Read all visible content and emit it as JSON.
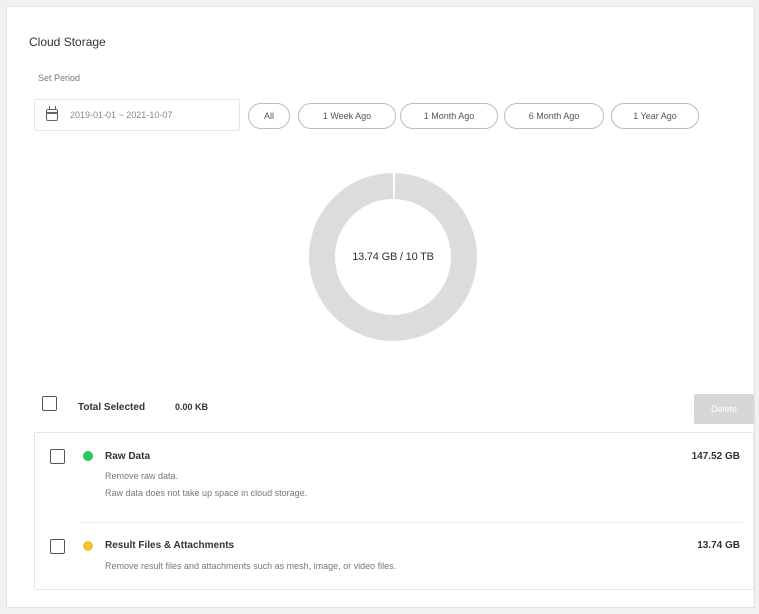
{
  "card": {
    "title": "Cloud Storage",
    "set_period_label": "Set Period",
    "date_range": "2019-01-01 ~ 2021-10-07"
  },
  "period_chips": [
    "All",
    "1 Week Ago",
    "1 Month Ago",
    "6 Month Ago",
    "1 Year Ago"
  ],
  "usage": {
    "label": "13.74 GB / 10 TB",
    "used_fraction": 0.0013,
    "ring_color": "#dcdcdc"
  },
  "selection": {
    "total_label": "Total Selected",
    "total_value": "0.00 KB",
    "delete_label": "Delete"
  },
  "items": [
    {
      "title": "Raw Data",
      "desc1": "Remove raw data.",
      "desc2": "Raw data does not take up space in cloud storage.",
      "size": "147.52 GB",
      "color": "#2ec463"
    },
    {
      "title": "Result Files & Attachments",
      "desc1": "Remove result files and attachments such as mesh, image, or video files.",
      "size": "13.74 GB",
      "color": "#f3c232"
    }
  ]
}
